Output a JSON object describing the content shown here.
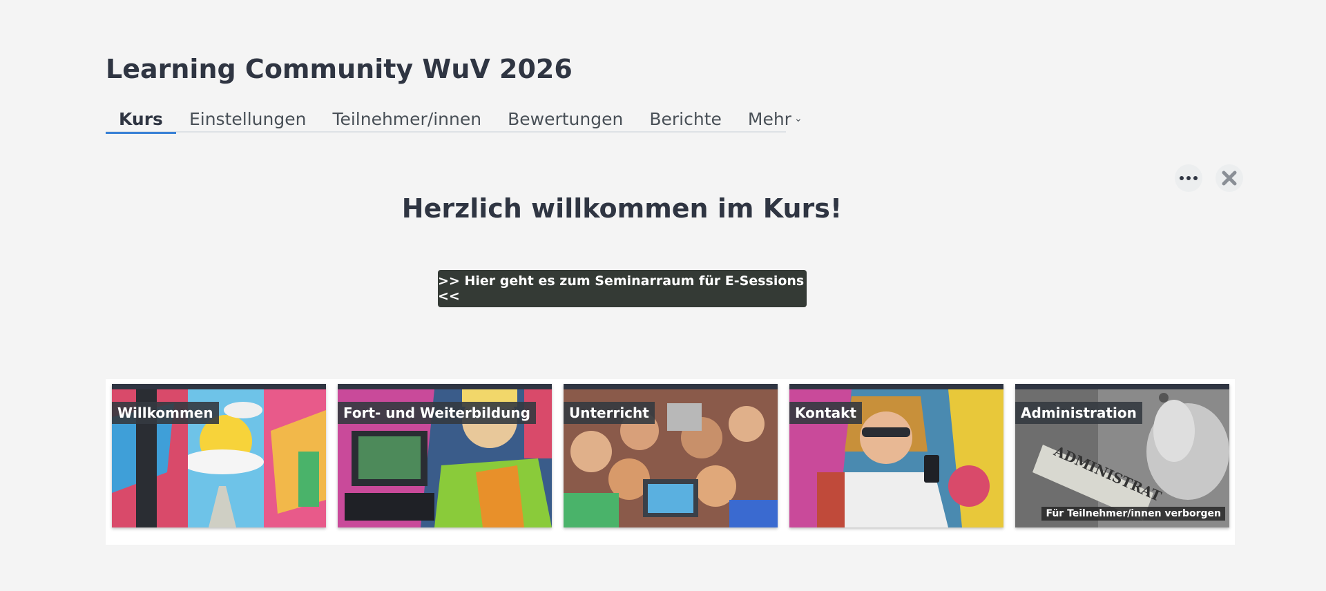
{
  "course": {
    "title": "Learning Community WuV 2026"
  },
  "nav": {
    "items": [
      {
        "label": "Kurs",
        "active": true
      },
      {
        "label": "Einstellungen"
      },
      {
        "label": "Teilnehmer/innen"
      },
      {
        "label": "Bewertungen"
      },
      {
        "label": "Berichte"
      },
      {
        "label": "Mehr",
        "has_dropdown": true
      }
    ]
  },
  "controls": {
    "more_icon": "ellipsis-icon",
    "close_icon": "close-icon"
  },
  "main": {
    "welcome": "Herzlich willkommen im Kurs!",
    "cta_label": ">> Hier geht es zum Seminarraum für E-Sessions <<"
  },
  "tiles": [
    {
      "label": "Willkommen"
    },
    {
      "label": "Fort- und Weiterbildung"
    },
    {
      "label": "Unterricht"
    },
    {
      "label": "Kontakt"
    },
    {
      "label": "Administration",
      "badge": "Für Teilnehmer/innen verborgen"
    }
  ],
  "colors": {
    "accent": "#3b82d6",
    "button": "#343a35",
    "tile_border": "#2f3542"
  }
}
